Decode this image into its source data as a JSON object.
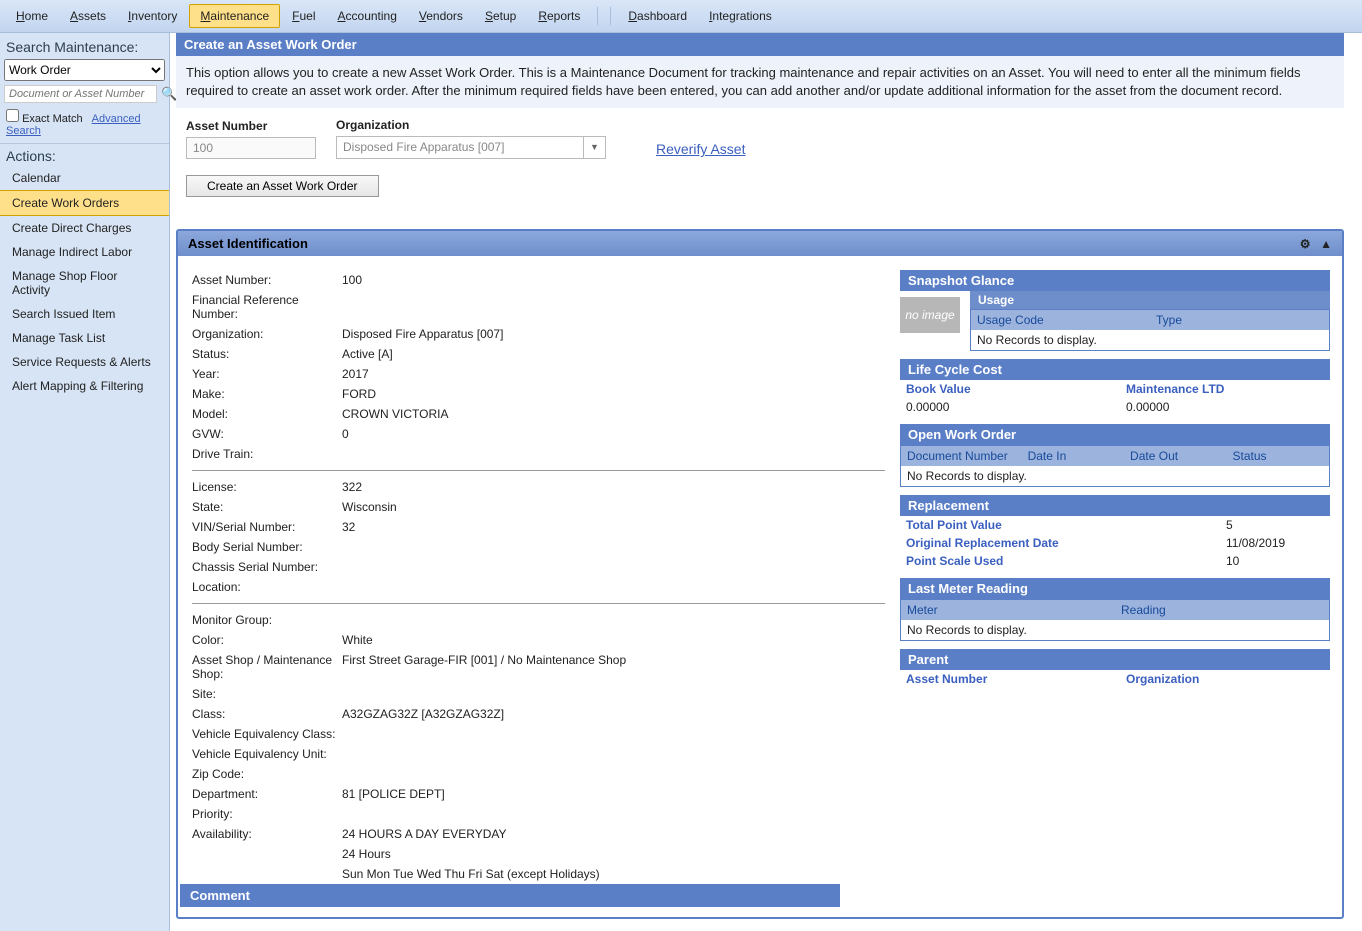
{
  "menus": [
    "Home",
    "Assets",
    "Inventory",
    "Maintenance",
    "Fuel",
    "Accounting",
    "Vendors",
    "Setup",
    "Reports",
    "Dashboard",
    "Integrations"
  ],
  "active_menu": "Maintenance",
  "sidebar": {
    "search_title": "Search Maintenance:",
    "type_value": "Work Order",
    "doc_placeholder": "Document or Asset Number",
    "exact": "Exact Match",
    "advanced": "Advanced Search",
    "actions_title": "Actions:",
    "items": [
      "Calendar",
      "Create Work Orders",
      "Create Direct Charges",
      "Manage Indirect Labor",
      "Manage Shop Floor Activity",
      "Search Issued Item",
      "Manage Task List",
      "Service Requests & Alerts",
      "Alert Mapping & Filtering"
    ],
    "active_item": "Create Work Orders"
  },
  "panel": {
    "title": "Create an Asset Work Order",
    "desc": "This option allows you to create a new Asset Work Order. This is a Maintenance Document for tracking maintenance and repair activities on an Asset. You will need to enter all the minimum fields required to create an asset work order. After the minimum required fields have been entered, you can add another and/or update additional information for the asset from the document record.",
    "asset_num_lbl": "Asset Number",
    "asset_num_val": "100",
    "org_lbl": "Organization",
    "org_val": "Disposed Fire Apparatus [007]",
    "reverify": "Reverify Asset",
    "btn": "Create an Asset Work Order"
  },
  "ident": {
    "title": "Asset Identification",
    "fields": [
      [
        "Asset Number:",
        "100"
      ],
      [
        "Financial Reference Number:",
        ""
      ],
      [
        "Organization:",
        "Disposed Fire Apparatus [007]"
      ],
      [
        "Status:",
        "Active [A]"
      ],
      [
        "Year:",
        "2017"
      ],
      [
        "Make:",
        "FORD"
      ],
      [
        "Model:",
        "CROWN VICTORIA"
      ],
      [
        "GVW:",
        "0"
      ],
      [
        "Drive Train:",
        ""
      ]
    ],
    "fields2": [
      [
        "License:",
        "322"
      ],
      [
        "State:",
        "Wisconsin"
      ],
      [
        "VIN/Serial Number:",
        "32"
      ],
      [
        "Body Serial Number:",
        ""
      ],
      [
        "Chassis Serial Number:",
        ""
      ],
      [
        "Location:",
        ""
      ]
    ],
    "fields3": [
      [
        "Monitor Group:",
        ""
      ],
      [
        "Color:",
        "White"
      ],
      [
        "Asset Shop / Maintenance Shop:",
        "First Street Garage-FIR [001] / No Maintenance Shop"
      ],
      [
        "Site:",
        ""
      ],
      [
        "Class:",
        "A32GZAG32Z [A32GZAG32Z]"
      ],
      [
        "Vehicle Equivalency Class:",
        ""
      ],
      [
        "Vehicle Equivalency Unit:",
        ""
      ],
      [
        "Zip Code:",
        ""
      ],
      [
        "Department:",
        "81 [POLICE DEPT]"
      ],
      [
        "Priority:",
        ""
      ],
      [
        "Availability:",
        "24 HOURS A DAY EVERYDAY"
      ],
      [
        "",
        "24 Hours"
      ],
      [
        "",
        "Sun Mon Tue Wed Thu Fri Sat (except Holidays)"
      ]
    ],
    "comment": "Comment"
  },
  "right": {
    "snapshot": "Snapshot Glance",
    "noimg": "no image",
    "usage": {
      "title": "Usage",
      "cols": [
        "Usage Code",
        "Type"
      ],
      "empty": "No Records to display."
    },
    "lifecycle": {
      "title": "Life Cycle Cost",
      "book": "Book Value",
      "book_v": "0.00000",
      "maint": "Maintenance LTD",
      "maint_v": "0.00000"
    },
    "openwo": {
      "title": "Open Work Order",
      "cols": [
        "Document Number",
        "Date In",
        "Date Out",
        "Status"
      ],
      "empty": "No Records to display."
    },
    "replace": {
      "title": "Replacement",
      "rows": [
        [
          "Total Point Value",
          "5"
        ],
        [
          "Original Replacement Date",
          "11/08/2019"
        ],
        [
          "Point Scale Used",
          "10"
        ]
      ]
    },
    "meter": {
      "title": "Last Meter Reading",
      "cols": [
        "Meter",
        "Reading"
      ],
      "empty": "No Records to display."
    },
    "parent": {
      "title": "Parent",
      "asset": "Asset Number",
      "org": "Organization"
    }
  }
}
